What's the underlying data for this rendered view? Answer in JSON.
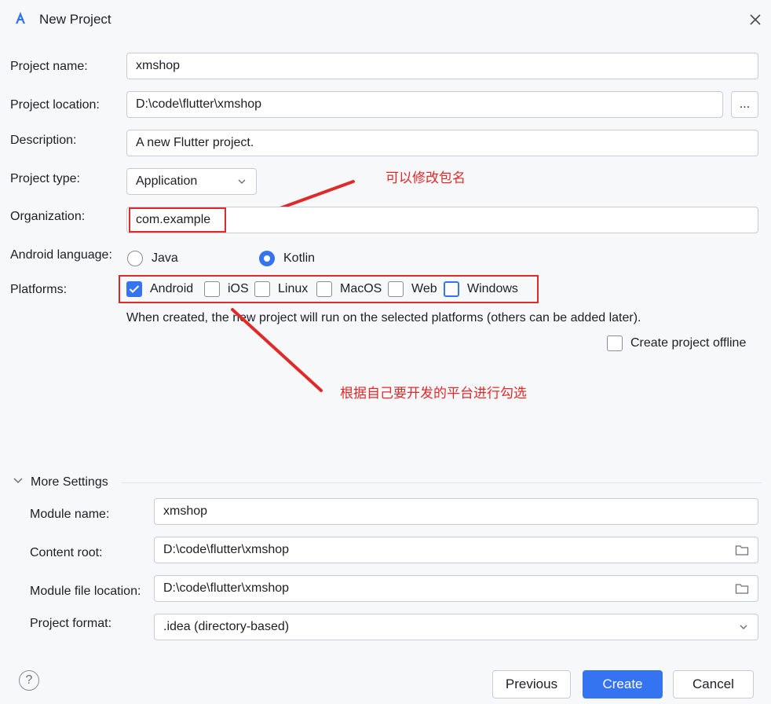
{
  "window": {
    "title": "New Project",
    "close_icon": "close-icon",
    "app_icon": "android-studio-icon"
  },
  "form": {
    "project_name": {
      "label": "Project name:",
      "value": "xmshop"
    },
    "project_location": {
      "label": "Project location:",
      "value": "D:\\code\\flutter\\xmshop",
      "browse_label": "..."
    },
    "description": {
      "label": "Description:",
      "value": "A new Flutter project."
    },
    "project_type": {
      "label": "Project type:",
      "value": "Application"
    },
    "organization": {
      "label": "Organization:",
      "value": "com.example"
    },
    "android_language": {
      "label": "Android language:",
      "options": [
        "Java",
        "Kotlin"
      ],
      "selected": "Kotlin"
    },
    "platforms": {
      "label": "Platforms:",
      "options": [
        {
          "label": "Android",
          "checked": true
        },
        {
          "label": "iOS",
          "checked": false
        },
        {
          "label": "Linux",
          "checked": false
        },
        {
          "label": "MacOS",
          "checked": false
        },
        {
          "label": "Web",
          "checked": false
        },
        {
          "label": "Windows",
          "checked": false
        }
      ],
      "hint": "When created, the new project will run on the selected platforms (others can be added later)."
    },
    "create_offline": {
      "label": "Create project offline",
      "checked": false
    }
  },
  "annotations": {
    "package_note": "可以修改包名",
    "platform_note": "根据自己要开发的平台进行勾选",
    "color": "#e02a2a"
  },
  "more_settings": {
    "title": "More Settings",
    "module_name": {
      "label": "Module name:",
      "value": "xmshop"
    },
    "content_root": {
      "label": "Content root:",
      "value": "D:\\code\\flutter\\xmshop"
    },
    "module_file_location": {
      "label": "Module file location:",
      "value": "D:\\code\\flutter\\xmshop"
    },
    "project_format": {
      "label": "Project format:",
      "value": ".idea (directory-based)"
    }
  },
  "footer": {
    "help_label": "?",
    "previous_label": "Previous",
    "create_label": "Create",
    "cancel_label": "Cancel"
  },
  "colors": {
    "accent": "#3574f0",
    "annotation": "#e02a2a",
    "background": "#f7f8fa"
  }
}
